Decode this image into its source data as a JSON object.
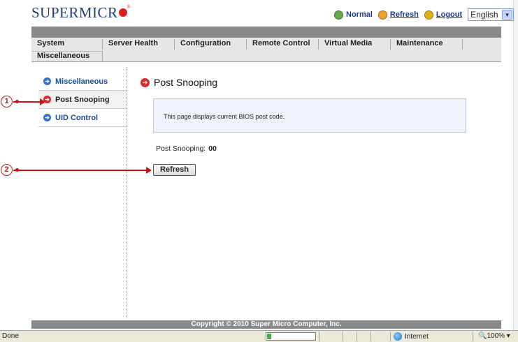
{
  "header": {
    "logo_text": "SUPERMICR",
    "reg_mark": "®",
    "status_label": "Normal",
    "refresh_link": "Refresh",
    "logout_link": "Logout",
    "language_selected": "English"
  },
  "nav": {
    "tabs": [
      "System",
      "Server Health",
      "Configuration",
      "Remote Control",
      "Virtual Media",
      "Maintenance"
    ],
    "second_row": "Miscellaneous"
  },
  "sidebar": {
    "items": [
      {
        "label": "Miscellaneous",
        "icon": "blue-arrow-icon"
      },
      {
        "label": "Post Snooping",
        "icon": "red-arrow-icon"
      },
      {
        "label": "UID Control",
        "icon": "blue-arrow-icon"
      }
    ]
  },
  "main": {
    "title": "Post Snooping",
    "info": "This page displays current BIOS post code.",
    "post_label": "Post Snooping:",
    "post_value": "00",
    "refresh_button": "Refresh"
  },
  "callouts": [
    "1",
    "2"
  ],
  "footer": {
    "copyright": "Copyright © 2010 Super Micro Computer, Inc."
  },
  "statusbar": {
    "left": "Done",
    "zone": "Internet",
    "zoom": "100%"
  },
  "colors": {
    "brand_blue": "#1f3f7a",
    "accent_red": "#cc1111",
    "nav_bg": "#e6e6e6",
    "bar_gray": "#8a8a8a"
  }
}
